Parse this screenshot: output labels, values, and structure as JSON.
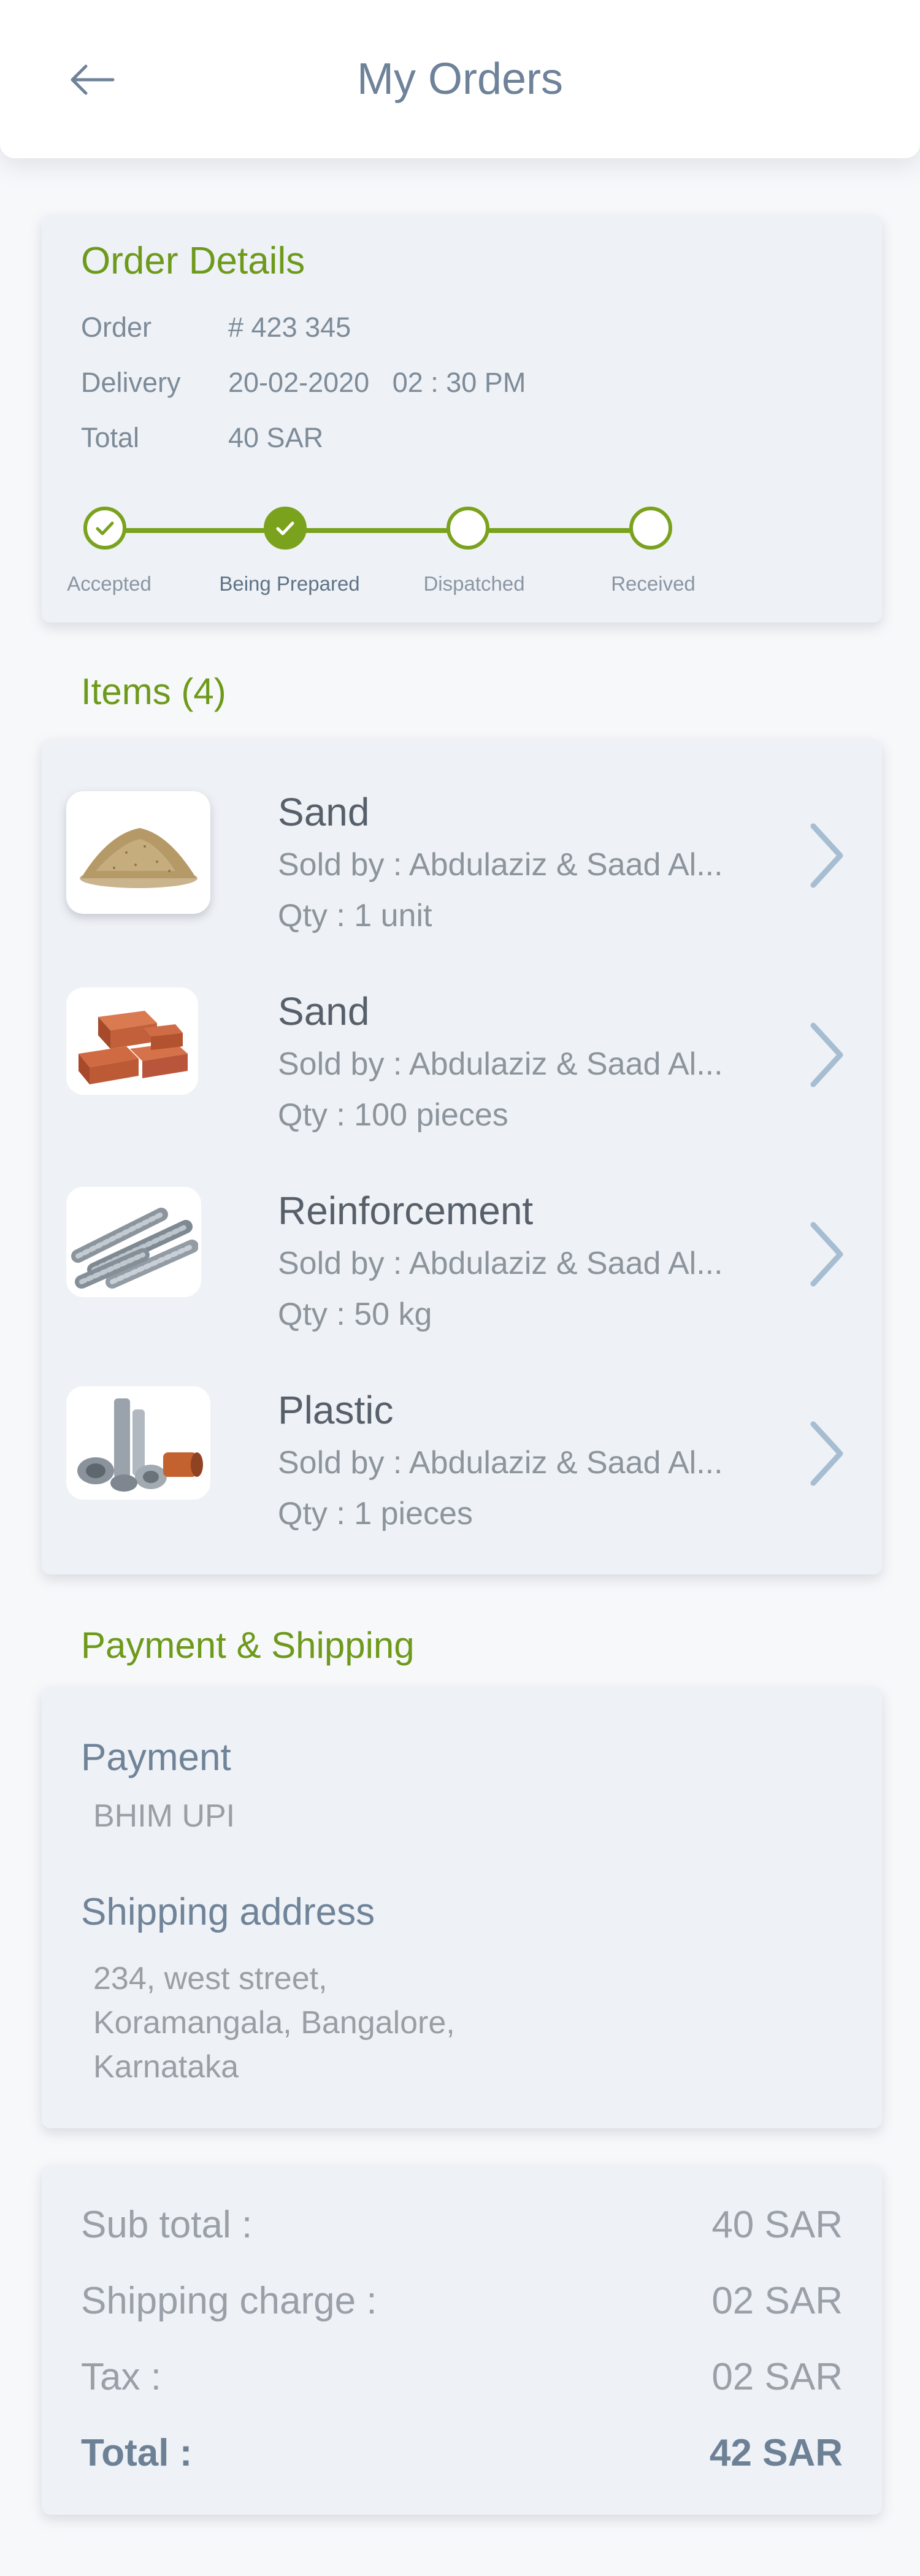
{
  "header": {
    "title": "My Orders"
  },
  "order_details": {
    "title": "Order Details",
    "rows": [
      {
        "label": "Order",
        "value": "# 423 345"
      },
      {
        "label": "Delivery",
        "value": "20-02-2020   02 : 30 PM"
      },
      {
        "label": "Total",
        "value": "40 SAR"
      }
    ],
    "steps": [
      {
        "label": "Accepted",
        "state": "done"
      },
      {
        "label": "Being Prepared",
        "state": "current"
      },
      {
        "label": "Dispatched",
        "state": "pending"
      },
      {
        "label": "Received",
        "state": "pending"
      }
    ]
  },
  "items": {
    "heading": "Items (4)",
    "list": [
      {
        "name": "Sand",
        "seller": "Sold by  : Abdulaziz & Saad Al...",
        "qty": "Qty  : 1 unit",
        "icon": "sand-pile"
      },
      {
        "name": "Sand",
        "seller": "Sold by  : Abdulaziz & Saad Al...",
        "qty": "Qty  : 100 pieces",
        "icon": "bricks"
      },
      {
        "name": "Reinforcement",
        "seller": "Sold by  : Abdulaziz & Saad Al...",
        "qty": "Qty  : 50 kg",
        "icon": "steel-rebar"
      },
      {
        "name": "Plastic",
        "seller": "Sold by  : Abdulaziz & Saad Al...",
        "qty": "Qty  : 1 pieces",
        "icon": "plastic-pipes"
      }
    ]
  },
  "payment_shipping": {
    "heading": "Payment & Shipping",
    "payment_label": "Payment",
    "payment_value": "BHIM UPI",
    "address_label": "Shipping address",
    "address_lines": [
      "234, west street,",
      "Koramangala, Bangalore,",
      "Karnataka"
    ]
  },
  "summary": {
    "rows": [
      {
        "label": "Sub total  :",
        "value": "40 SAR"
      },
      {
        "label": "Shipping charge  :",
        "value": "02 SAR"
      },
      {
        "label": "Tax  :",
        "value": "02 SAR"
      },
      {
        "label": "Total  :",
        "value": "42 SAR"
      }
    ]
  },
  "colors": {
    "accent_green": "#7aa21d",
    "heading_blue_grey": "#6e8299",
    "card_bg": "#eef1f5"
  }
}
